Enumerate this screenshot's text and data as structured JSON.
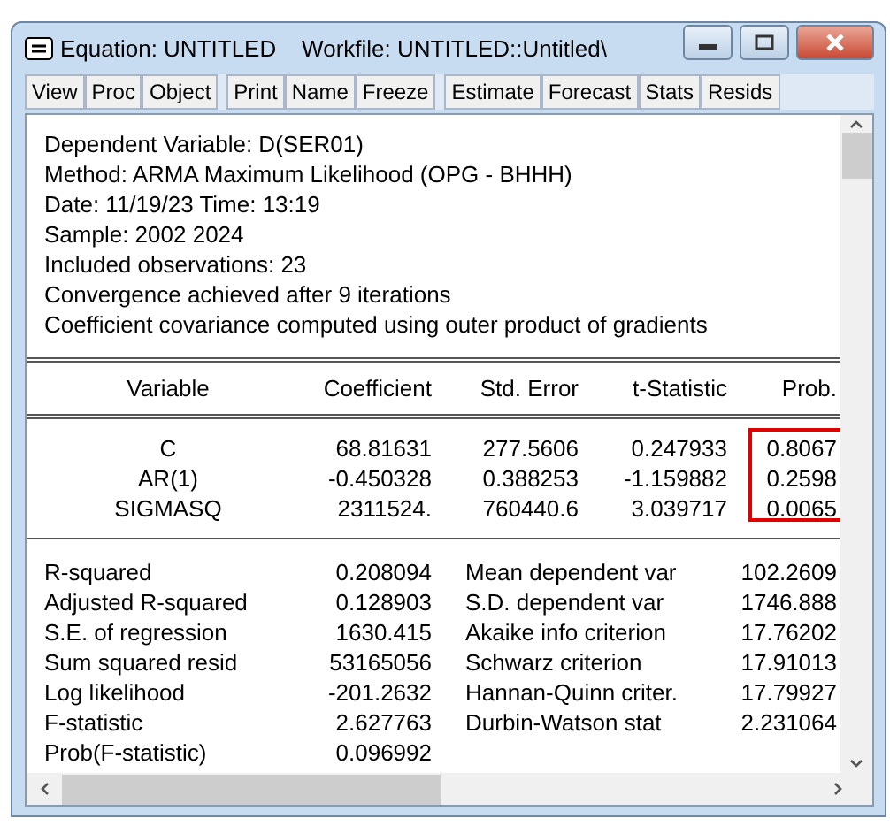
{
  "window": {
    "title": "Equation: UNTITLED    Workfile: UNTITLED::Untitled\\"
  },
  "toolbar_groups": [
    [
      "View",
      "Proc",
      "Object"
    ],
    [
      "Print",
      "Name",
      "Freeze"
    ],
    [
      "Estimate",
      "Forecast",
      "Stats",
      "Resids"
    ]
  ],
  "header_lines": [
    "Dependent Variable: D(SER01)",
    "Method: ARMA Maximum Likelihood (OPG - BHHH)",
    "Date: 11/19/23   Time: 13:19",
    "Sample: 2002 2024",
    "Included observations: 23",
    "Convergence achieved after 9 iterations",
    "Coefficient covariance computed using outer product of gradients"
  ],
  "table": {
    "columns": [
      "Variable",
      "Coefficient",
      "Std. Error",
      "t-Statistic",
      "Prob."
    ],
    "rows": [
      [
        "C",
        "68.81631",
        "277.5606",
        "0.247933",
        "0.8067"
      ],
      [
        "AR(1)",
        "-0.450328",
        "0.388253",
        "-1.159882",
        "0.2598"
      ],
      [
        "SIGMASQ",
        "2311524.",
        "760440.6",
        "3.039717",
        "0.0065"
      ]
    ],
    "prob_highlighted": true
  },
  "stats": [
    [
      "R-squared",
      "0.208094",
      "Mean dependent var",
      "102.2609"
    ],
    [
      "Adjusted R-squared",
      "0.128903",
      "S.D. dependent var",
      "1746.888"
    ],
    [
      "S.E. of regression",
      "1630.415",
      "Akaike info criterion",
      "17.76202"
    ],
    [
      "Sum squared resid",
      "53165056",
      "Schwarz criterion",
      "17.91013"
    ],
    [
      "Log likelihood",
      "-201.2632",
      "Hannan-Quinn criter.",
      "17.79927"
    ],
    [
      "F-statistic",
      "2.627763",
      "Durbin-Watson stat",
      "2.231064"
    ],
    [
      "Prob(F-statistic)",
      "0.096992"
    ]
  ]
}
